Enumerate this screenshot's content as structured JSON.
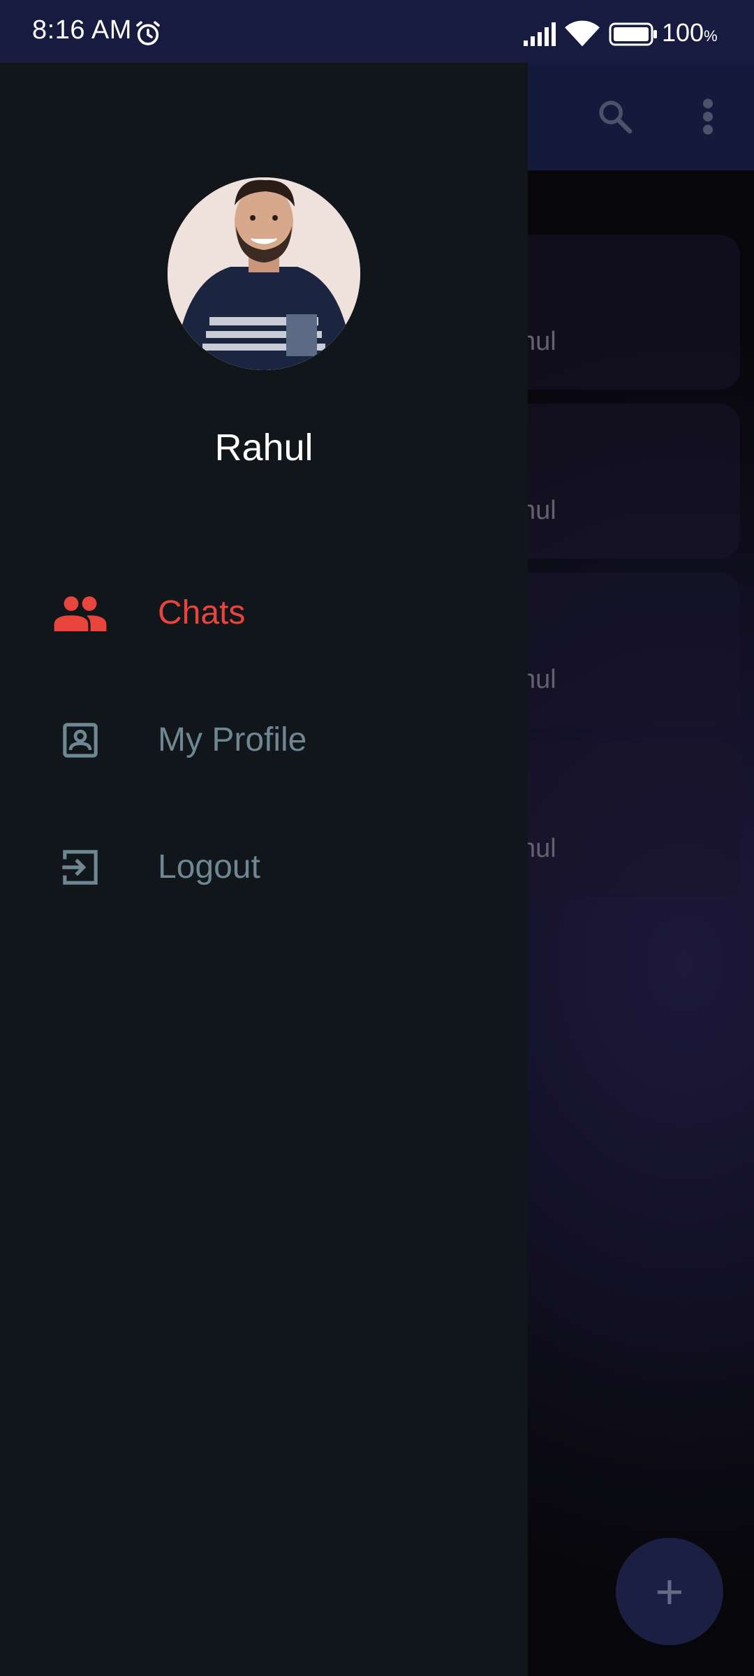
{
  "status_bar": {
    "time": "8:16 AM",
    "battery_percent": "100",
    "battery_unit": "%",
    "icons": [
      "alarm-icon",
      "signal-icon",
      "wifi-icon",
      "battery-icon"
    ]
  },
  "app_bar": {
    "icons": [
      "search-icon",
      "more-vert-icon"
    ]
  },
  "chat_list": [
    {
      "name": "hul"
    },
    {
      "name": "hul"
    },
    {
      "name": "hul"
    },
    {
      "name": "hul"
    }
  ],
  "fab": {
    "label": "+",
    "icon": "plus-icon"
  },
  "drawer": {
    "profile_name": "Rahul",
    "items": [
      {
        "label": "Chats",
        "icon": "group-icon",
        "active": true
      },
      {
        "label": "My Profile",
        "icon": "profile-icon",
        "active": false
      },
      {
        "label": "Logout",
        "icon": "logout-icon",
        "active": false
      }
    ]
  },
  "colors": {
    "status_bar": "#181b40",
    "app_bar": "#1d2452",
    "drawer_bg": "#11161a",
    "active": "#e8453c",
    "inactive": "#6f8793",
    "fab": "#252b5e"
  }
}
